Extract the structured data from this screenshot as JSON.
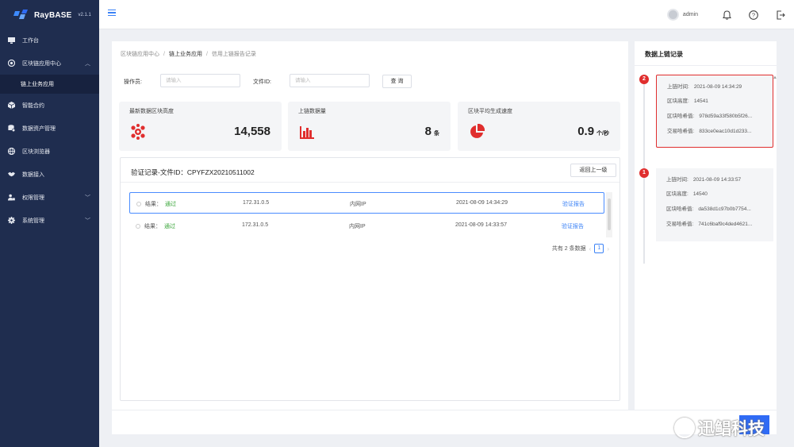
{
  "app": {
    "name": "RayBASE",
    "version": "v2.1.1"
  },
  "sidebar": {
    "items": [
      {
        "label": "工作台",
        "icon": "workspace-icon"
      },
      {
        "label": "区块链应用中心",
        "icon": "chain-app-icon",
        "expanded": true
      },
      {
        "label": "链上业务应用",
        "icon": "",
        "sub": true,
        "active": true
      },
      {
        "label": "智能合约",
        "icon": "cube-icon"
      },
      {
        "label": "数据资产管理",
        "icon": "database-icon"
      },
      {
        "label": "区块浏览器",
        "icon": "globe-icon"
      },
      {
        "label": "数据接入",
        "icon": "handshake-icon"
      },
      {
        "label": "权限管理",
        "icon": "user-lock-icon",
        "has_children": true
      },
      {
        "label": "系统管理",
        "icon": "gear-icon",
        "has_children": true
      }
    ]
  },
  "topbar": {
    "username": "admin"
  },
  "breadcrumb": {
    "items": [
      "区块链应用中心",
      "链上业务应用",
      "信用上链报告记录"
    ]
  },
  "filter": {
    "operator_label": "操作员:",
    "operator_placeholder": "请输入",
    "file_label": "文件ID:",
    "file_placeholder": "请输入",
    "query_button": "查 询"
  },
  "stats": [
    {
      "title": "最新数据区块高度",
      "value": "14,558",
      "unit": "",
      "icon": "molecule-icon"
    },
    {
      "title": "上链数据量",
      "value": "8",
      "unit": "条",
      "icon": "bar-chart-icon"
    },
    {
      "title": "区块平均生成速度",
      "value": "0.9",
      "unit": "个/秒",
      "icon": "pie-chart-icon"
    }
  ],
  "records": {
    "title": "验证记录-文件ID：CPYFZX20210511002",
    "back_button": "返回上一级",
    "rows": [
      {
        "result_label": "结果：",
        "result": "通过",
        "ip": "172.31.0.5",
        "ip_type": "内网IP",
        "time": "2021-08-09 14:34:29",
        "link": "验证报告",
        "selected": true
      },
      {
        "result_label": "结果：",
        "result": "通过",
        "ip": "172.31.0.5",
        "ip_type": "内网IP",
        "time": "2021-08-09 14:33:57",
        "link": "验证报告",
        "selected": false
      }
    ],
    "pager": {
      "total_text": "共有 2 条数据",
      "page": "1"
    }
  },
  "side": {
    "title": "数据上链记录",
    "entries": [
      {
        "badge": "2",
        "time_label": "上链时间:",
        "time": "2021-08-09 14:34:29",
        "height_label": "区块高度:",
        "height": "14541",
        "block_hash_label": "区块哈希值:",
        "block_hash": "978d59a33f580b5f26...",
        "tx_hash_label": "交易哈希值:",
        "tx_hash": "833ce0eac10d1d233...",
        "highlight": true
      },
      {
        "badge": "1",
        "time_label": "上链时间:",
        "time": "2021-08-09 14:33:57",
        "height_label": "区块高度:",
        "height": "14540",
        "block_hash_label": "区块哈希值:",
        "block_hash": "da538d1c97b0b7754...",
        "tx_hash_label": "交易哈希值:",
        "tx_hash": "741c6baf9c4ded4621...",
        "highlight": false
      }
    ]
  },
  "watermark": {
    "text": "迅鲳科技"
  },
  "colors": {
    "sidebar": "#1f2d4f",
    "accent": "#3b82f6",
    "danger": "#e02e2e",
    "success": "#3aa63a"
  }
}
